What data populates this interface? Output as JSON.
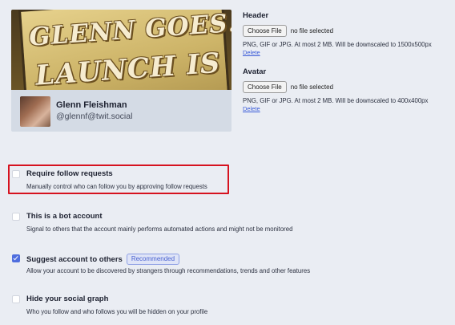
{
  "profile_preview": {
    "banner_line_1": "GLENN GOES!",
    "banner_line_2": "LAUNCH IS OK",
    "display_name": "Glenn Fleishman",
    "handle": "@glennf@twit.social"
  },
  "header_upload": {
    "title": "Header",
    "button_label": "Choose File",
    "status": "no file selected",
    "hint": "PNG, GIF or JPG. At most 2 MB. Will be downscaled to 1500x500px",
    "delete_label": "Delete"
  },
  "avatar_upload": {
    "title": "Avatar",
    "button_label": "Choose File",
    "status": "no file selected",
    "hint": "PNG, GIF or JPG. At most 2 MB. Will be downscaled to 400x400px",
    "delete_label": "Delete"
  },
  "options": {
    "require_follow": {
      "label": "Require follow requests",
      "description": "Manually control who can follow you by approving follow requests",
      "checked": false
    },
    "bot_account": {
      "label": "This is a bot account",
      "description": "Signal to others that the account mainly performs automated actions and might not be monitored",
      "checked": false
    },
    "suggest_account": {
      "label": "Suggest account to others",
      "badge": "Recommended",
      "description": "Allow your account to be discovered by strangers through recommendations, trends and other features",
      "checked": true
    },
    "hide_graph": {
      "label": "Hide your social graph",
      "description": "Who you follow and who follows you will be hidden on your profile",
      "checked": false
    }
  },
  "colors": {
    "background": "#eaedf3",
    "accent": "#4f6ede",
    "highlight_box": "#d6121f",
    "link": "#3a5bd8"
  }
}
